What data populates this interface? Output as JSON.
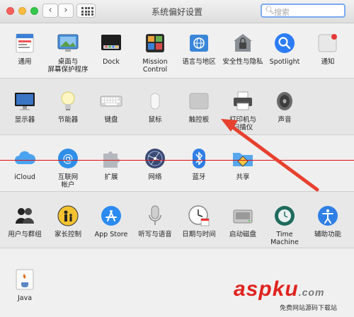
{
  "window": {
    "title": "系统偏好设置",
    "search_placeholder": "搜索"
  },
  "rows": [
    [
      {
        "label": "通用",
        "icon": "general-icon"
      },
      {
        "label": "桌面与\n屏幕保护程序",
        "icon": "desktop-screensaver-icon"
      },
      {
        "label": "Dock",
        "icon": "dock-icon"
      },
      {
        "label": "Mission\nControl",
        "icon": "mission-control-icon"
      },
      {
        "label": "语言与地区",
        "icon": "language-region-icon"
      },
      {
        "label": "安全性与隐私",
        "icon": "security-privacy-icon"
      },
      {
        "label": "Spotlight",
        "icon": "spotlight-icon"
      },
      {
        "label": "通知",
        "icon": "notifications-icon"
      }
    ],
    [
      {
        "label": "显示器",
        "icon": "displays-icon"
      },
      {
        "label": "节能器",
        "icon": "energy-saver-icon"
      },
      {
        "label": "键盘",
        "icon": "keyboard-icon"
      },
      {
        "label": "鼠标",
        "icon": "mouse-icon"
      },
      {
        "label": "触控板",
        "icon": "trackpad-icon"
      },
      {
        "label": "打印机与\n扫描仪",
        "icon": "printers-scanners-icon"
      },
      {
        "label": "声音",
        "icon": "sound-icon"
      }
    ],
    [
      {
        "label": "iCloud",
        "icon": "icloud-icon"
      },
      {
        "label": "互联网\n帐户",
        "icon": "internet-accounts-icon"
      },
      {
        "label": "扩展",
        "icon": "extensions-icon"
      },
      {
        "label": "网络",
        "icon": "network-icon"
      },
      {
        "label": "蓝牙",
        "icon": "bluetooth-icon"
      },
      {
        "label": "共享",
        "icon": "sharing-icon"
      }
    ],
    [
      {
        "label": "用户与群组",
        "icon": "users-groups-icon"
      },
      {
        "label": "家长控制",
        "icon": "parental-controls-icon"
      },
      {
        "label": "App Store",
        "icon": "app-store-icon"
      },
      {
        "label": "听写与语音",
        "icon": "dictation-speech-icon"
      },
      {
        "label": "日期与时间",
        "icon": "date-time-icon"
      },
      {
        "label": "启动磁盘",
        "icon": "startup-disk-icon"
      },
      {
        "label": "Time Machine",
        "icon": "time-machine-icon"
      },
      {
        "label": "辅助功能",
        "icon": "accessibility-icon"
      }
    ],
    [
      {
        "label": "Java",
        "icon": "java-icon"
      }
    ]
  ],
  "watermark": {
    "brand": "aspku",
    "suffix": ".com",
    "tagline": "免费网站源码下载站"
  },
  "colors": {
    "annotation_red": "#e0231f",
    "accent_blue": "#2d7cf6"
  }
}
